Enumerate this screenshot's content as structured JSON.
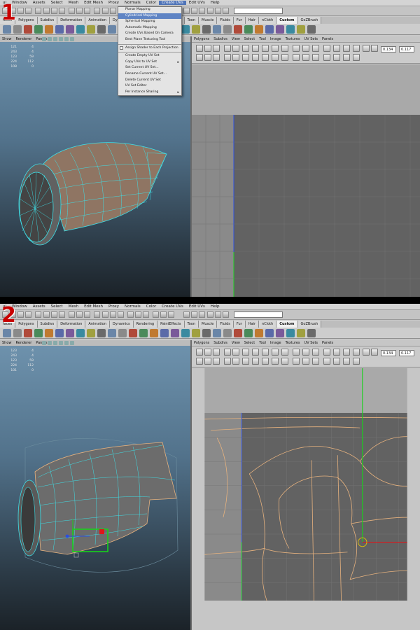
{
  "menubar": [
    "ui",
    "Window",
    "Assets",
    "Select",
    "Mesh",
    "Edit Mesh",
    "Proxy",
    "Normals",
    "Color",
    "Create UVs",
    "Edit UVs",
    "Help"
  ],
  "menubar_active": "Create UVs",
  "shelf_tabs": [
    "faces",
    "Polygons",
    "Subdivs",
    "Deformation",
    "Animation",
    "Dynamics",
    "Rendering",
    "PaintEffects",
    "Toon",
    "Muscle",
    "Fluids",
    "Fur",
    "Hair",
    "nCloth",
    "Custom",
    "GoZBrush"
  ],
  "shelf_tab_current": "Custom",
  "viewport_menu": [
    "Show",
    "Renderer",
    "Panels"
  ],
  "uv_menu": [
    "Polygons",
    "Subdivs",
    "View",
    "Select",
    "Tool",
    "Image",
    "Textures",
    "UV Sets",
    "Panels"
  ],
  "panel1": {
    "step_label": "1",
    "hud": [
      [
        "121",
        "4"
      ],
      [
        "243",
        "4"
      ],
      [
        "123",
        "59"
      ],
      [
        "224",
        "112"
      ],
      [
        "108",
        "0"
      ]
    ],
    "uv_u": "0.134",
    "uv_v": "0.117"
  },
  "panel2": {
    "step_label": "2",
    "hud": [
      [
        "123",
        "4"
      ],
      [
        "243",
        "4"
      ],
      [
        "123",
        "59"
      ],
      [
        "224",
        "112"
      ],
      [
        "101",
        "0"
      ]
    ],
    "uv_u": "0.134",
    "uv_v": "0.117"
  },
  "dropdown": {
    "items": [
      {
        "label": "Planar Mapping",
        "highlight": false,
        "submenu": false,
        "option": false
      },
      {
        "label": "Cylindrical Mapping",
        "highlight": true,
        "submenu": false,
        "option": false
      },
      {
        "label": "Spherical Mapping",
        "highlight": false,
        "submenu": false,
        "option": false
      },
      {
        "label": "Automatic Mapping",
        "highlight": false,
        "submenu": false,
        "option": false
      },
      {
        "label": "Create UVs Based On Camera",
        "highlight": false,
        "submenu": false,
        "option": false
      },
      {
        "label": "Best Plane Texturing Tool",
        "highlight": false,
        "submenu": false,
        "option": false
      },
      {
        "label": "Assign Shader to Each Projection",
        "highlight": false,
        "submenu": false,
        "option": true
      },
      {
        "label": "Create Empty UV Set",
        "highlight": false,
        "submenu": false,
        "option": false
      },
      {
        "label": "Copy UVs to UV Set",
        "highlight": false,
        "submenu": true,
        "option": false
      },
      {
        "label": "Set Current UV Set...",
        "highlight": false,
        "submenu": false,
        "option": false
      },
      {
        "label": "Rename Current UV Set...",
        "highlight": false,
        "submenu": false,
        "option": false
      },
      {
        "label": "Delete Current UV Set",
        "highlight": false,
        "submenu": false,
        "option": false
      },
      {
        "label": "UV Set Editor",
        "highlight": false,
        "submenu": false,
        "option": false
      },
      {
        "label": "Per Instance Sharing",
        "highlight": false,
        "submenu": true,
        "option": false
      }
    ],
    "separators_after": [
      5,
      6
    ]
  },
  "colors": {
    "wire": "#3ee0e8",
    "body_fill": "#8f7563",
    "uv_edge": "#e7b27e",
    "manip_green": "#17d21a",
    "manip_red": "#e0151a",
    "manip_blue": "#2a4ee0",
    "step_red": "#c90000",
    "menu_highlight": "#4f74b8"
  }
}
